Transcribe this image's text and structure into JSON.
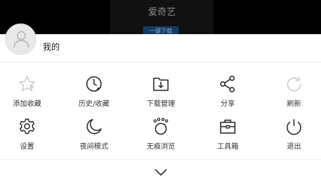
{
  "background": {
    "title": "爱奇艺",
    "button": "一键下载"
  },
  "profile": {
    "label": "我的"
  },
  "menu": [
    {
      "label": "添加收藏",
      "icon": "star-icon"
    },
    {
      "label": "历史/收藏",
      "icon": "history-icon"
    },
    {
      "label": "下载管理",
      "icon": "download-folder-icon"
    },
    {
      "label": "分享",
      "icon": "share-icon"
    },
    {
      "label": "刷新",
      "icon": "refresh-icon"
    },
    {
      "label": "设置",
      "icon": "gear-icon"
    },
    {
      "label": "夜间模式",
      "icon": "moon-icon"
    },
    {
      "label": "无痕浏览",
      "icon": "incognito-icon"
    },
    {
      "label": "工具箱",
      "icon": "toolbox-icon"
    },
    {
      "label": "退出",
      "icon": "power-icon"
    }
  ],
  "colors": {
    "icon_stroke": "#222222",
    "icon_disabled": "#c8c8c8"
  }
}
